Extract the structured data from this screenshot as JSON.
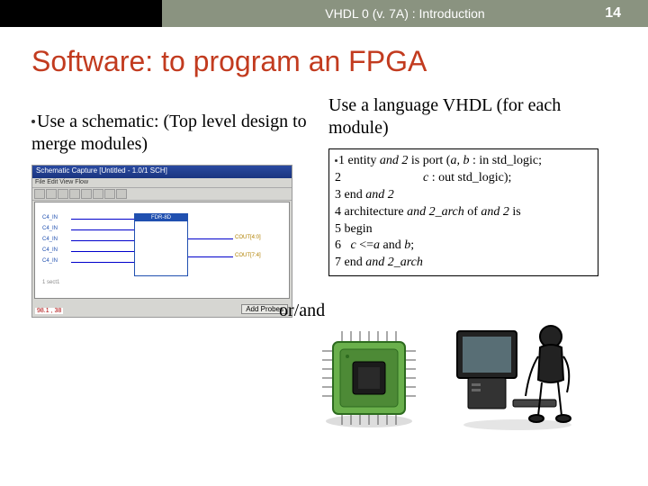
{
  "header": {
    "breadcrumb": "VHDL 0 (v. 7A) : Introduction",
    "page_number": "14"
  },
  "slide": {
    "title": "Software: to program an FPGA"
  },
  "left": {
    "heading": "Use a schematic: (Top level design to merge modules)",
    "schematic": {
      "titlebar": "Schematic Capture  [Untitled - 1.0/1  SCH]",
      "menubar": "File  Edit  View  Flow",
      "block_label": "FDR-8D",
      "io_labels": [
        "C4_IN",
        "C4_IN",
        "C4_IN",
        "C4_IN",
        "C4_IN"
      ],
      "out_labels": [
        "COUT[4:0]",
        "COUT[7:4]"
      ],
      "coord": "98.1 , 38",
      "add_probes": "Add Probes"
    }
  },
  "right": {
    "heading": "Use a language VHDL (for each module)",
    "code": {
      "l1a": "1 entity ",
      "l1b": "and 2",
      "l1c": " is port (",
      "l1d": "a, b",
      "l1e": " : in std_logic;",
      "l2a": "2                          ",
      "l2b": "c",
      "l2c": " : out std_logic);",
      "l3a": "3 end ",
      "l3b": "and 2",
      "l4a": "4 architecture ",
      "l4b": "and 2_arch",
      "l4c": " of ",
      "l4d": "and 2",
      "l4e": " is",
      "l5": "5 begin",
      "l6a": "6   ",
      "l6b": "c",
      "l6c": " <=",
      "l6d": "a",
      "l6e": " and ",
      "l6f": "b",
      "l6g": ";",
      "l7a": "7 end ",
      "l7b": "and 2_arch"
    }
  },
  "middle": {
    "or_and": "or/and"
  },
  "icons": {
    "chip": "fpga-chip-icon",
    "computer": "computer-user-icon"
  }
}
